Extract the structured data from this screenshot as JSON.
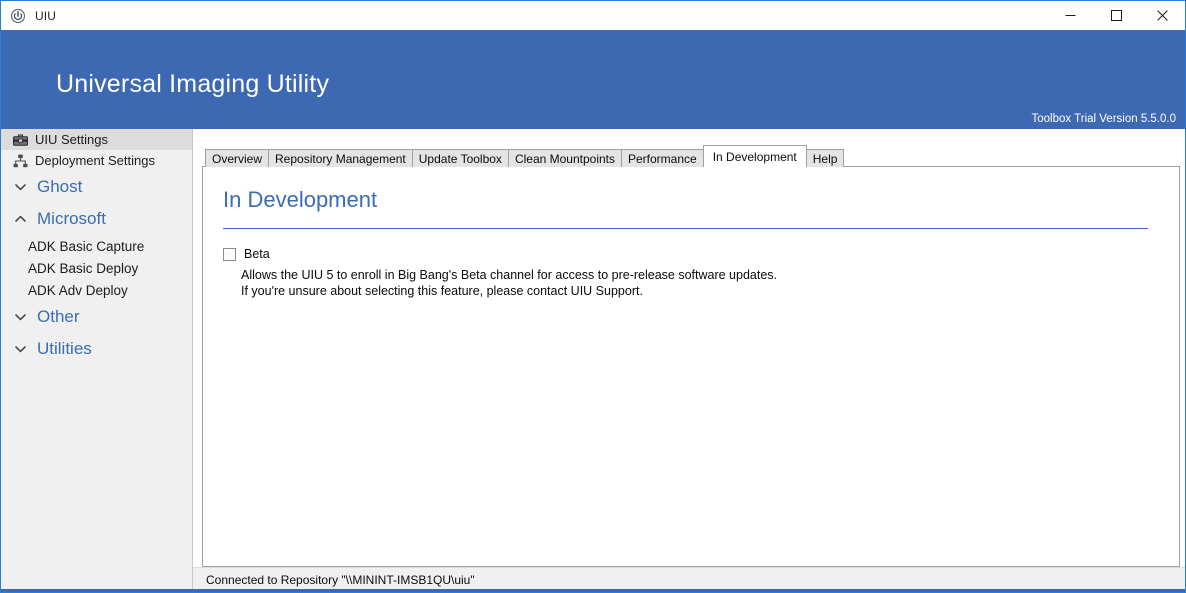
{
  "window": {
    "title": "UIU",
    "icon": "power-button-icon",
    "controls": {
      "minimize": "minimize-icon",
      "maximize": "maximize-icon",
      "close": "close-icon"
    },
    "accent_color": "#3d68b2",
    "border_color": "#2a7fd4"
  },
  "header": {
    "title": "Universal Imaging Utility",
    "version": "Toolbox Trial Version 5.5.0.0",
    "background_color": "#3d68b2",
    "text_color": "#ffffff"
  },
  "sidebar": {
    "background_color": "#f0f0f0",
    "group_text_color": "#3b6cb4",
    "items": [
      {
        "label": "UIU Settings",
        "icon": "toolbox-icon",
        "type": "item",
        "selected": true
      },
      {
        "label": "Deployment Settings",
        "icon": "hierarchy-icon",
        "type": "item",
        "selected": false
      },
      {
        "label": "Ghost",
        "icon": "chevron-down-icon",
        "type": "group",
        "expanded": false
      },
      {
        "label": "Microsoft",
        "icon": "chevron-up-icon",
        "type": "group",
        "expanded": true
      },
      {
        "label": "ADK Basic Capture",
        "type": "child"
      },
      {
        "label": "ADK Basic Deploy",
        "type": "child"
      },
      {
        "label": "ADK Adv Deploy",
        "type": "child"
      },
      {
        "label": "Other",
        "icon": "chevron-down-icon",
        "type": "group",
        "expanded": false
      },
      {
        "label": "Utilities",
        "icon": "chevron-down-icon",
        "type": "group",
        "expanded": false
      }
    ]
  },
  "tabs": [
    {
      "label": "Overview",
      "active": false
    },
    {
      "label": "Repository Management",
      "active": false
    },
    {
      "label": "Update Toolbox",
      "active": false
    },
    {
      "label": "Clean Mountpoints",
      "active": false
    },
    {
      "label": "Performance",
      "active": false
    },
    {
      "label": "In Development",
      "active": true
    },
    {
      "label": "Help",
      "active": false
    }
  ],
  "panel": {
    "heading": "In Development",
    "heading_color": "#3b6cb4",
    "beta": {
      "label": "Beta",
      "checked": false,
      "description_line_1": "Allows the UIU 5 to enroll in Big Bang's Beta channel for access to pre-release software updates.",
      "description_line_2": "If you're unsure about selecting this feature, please contact UIU Support."
    }
  },
  "statusbar": {
    "text": "Connected to Repository \"\\\\MININT-IMSB1QU\\uiu\""
  }
}
